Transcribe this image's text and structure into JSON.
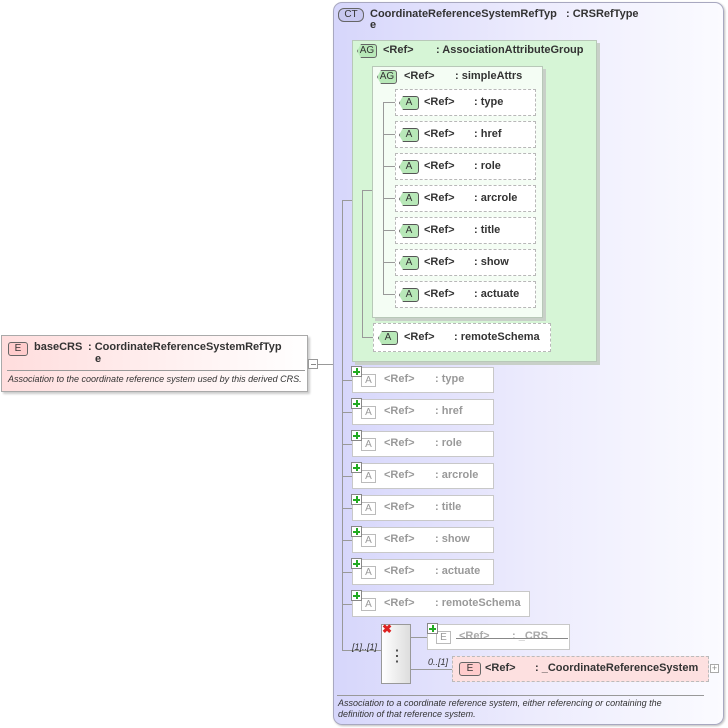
{
  "complex_type": {
    "badge": "CT",
    "name": "CoordinateReferenceSystemRefTyp",
    "name_wrap": "e",
    "type": ": CRSRefType",
    "description": "Association to a coordinate reference system, either referencing or containing the definition of that reference system."
  },
  "attribute_group": {
    "badge": "AG",
    "ref": "<Ref>",
    "name": ": AssociationAttributeGroup"
  },
  "inner_group": {
    "badge": "AG",
    "ref": "<Ref>",
    "name": ": simpleAttrs"
  },
  "attributes": [
    {
      "badge": "A",
      "ref": "<Ref>",
      "name": ": type"
    },
    {
      "badge": "A",
      "ref": "<Ref>",
      "name": ": href"
    },
    {
      "badge": "A",
      "ref": "<Ref>",
      "name": ": role"
    },
    {
      "badge": "A",
      "ref": "<Ref>",
      "name": ": arcrole"
    },
    {
      "badge": "A",
      "ref": "<Ref>",
      "name": ": title"
    },
    {
      "badge": "A",
      "ref": "<Ref>",
      "name": ": show"
    },
    {
      "badge": "A",
      "ref": "<Ref>",
      "name": ": actuate"
    }
  ],
  "remote_schema": {
    "badge": "A",
    "ref": "<Ref>",
    "name": ": remoteSchema"
  },
  "inherited_attributes": [
    {
      "badge": "A",
      "ref": "<Ref>",
      "name": ": type"
    },
    {
      "badge": "A",
      "ref": "<Ref>",
      "name": ": href"
    },
    {
      "badge": "A",
      "ref": "<Ref>",
      "name": ": role"
    },
    {
      "badge": "A",
      "ref": "<Ref>",
      "name": ": arcrole"
    },
    {
      "badge": "A",
      "ref": "<Ref>",
      "name": ": title"
    },
    {
      "badge": "A",
      "ref": "<Ref>",
      "name": ": show"
    },
    {
      "badge": "A",
      "ref": "<Ref>",
      "name": ": actuate"
    },
    {
      "badge": "A",
      "ref": "<Ref>",
      "name": ": remoteSchema"
    }
  ],
  "choice": {
    "cardinality": "[1]..[1]"
  },
  "crs_element": {
    "badge": "E",
    "ref": "<Ref>",
    "name": ": _CRS"
  },
  "crs_ref_element": {
    "badge": "E",
    "ref": "<Ref>",
    "name": ": _CoordinateReferenceSystem",
    "cardinality": "0..[1]"
  },
  "base_element": {
    "badge": "E",
    "name": "baseCRS",
    "type": ": CoordinateReferenceSystemRefTyp",
    "type_wrap": "e",
    "description": "Association to the coordinate reference system used by this derived CRS."
  }
}
